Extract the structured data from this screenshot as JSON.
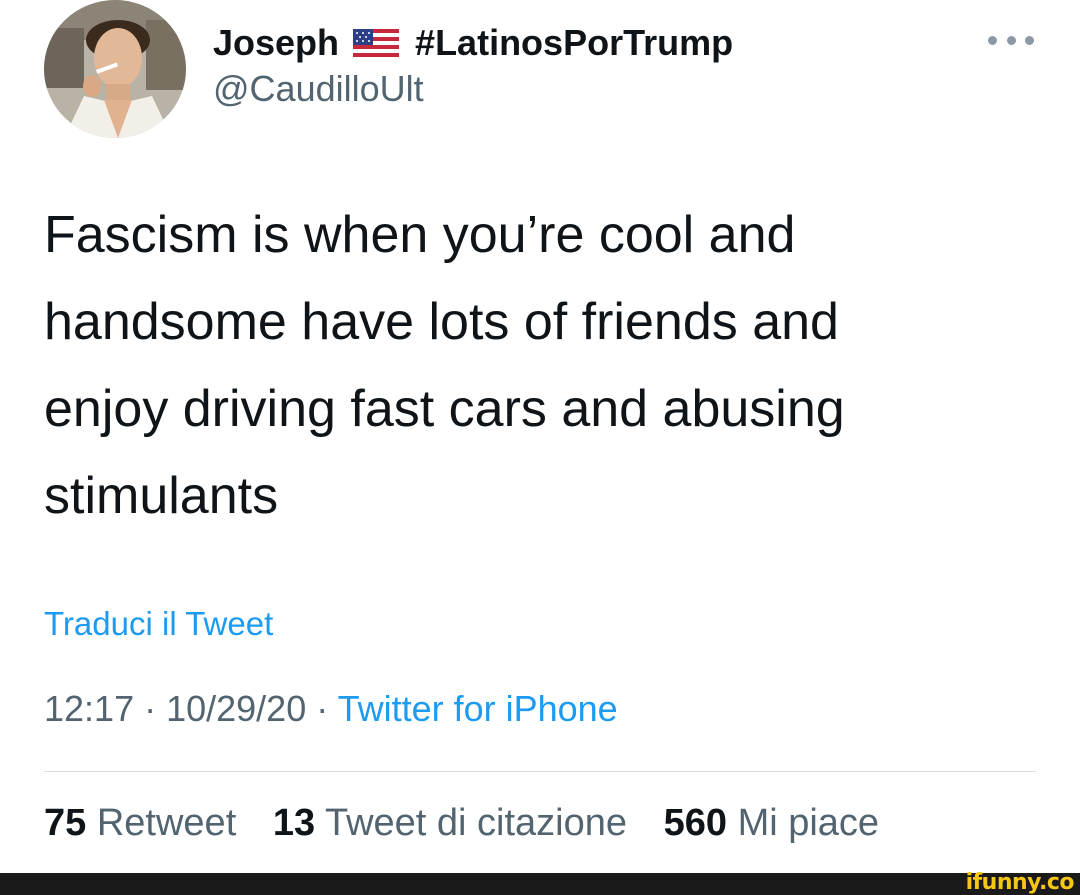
{
  "tweet": {
    "author": {
      "display_name": "Joseph",
      "flag_icon": "us-flag-icon",
      "hashtag": "#LatinosPorTrump",
      "handle": "@CaudilloUlt"
    },
    "text_lines": [
      "Fascism is when you’re cool and",
      "handsome have lots of friends and",
      "enjoy driving fast cars and abusing",
      "stimulants"
    ],
    "translate_label": "Traduci il Tweet",
    "meta": {
      "time": "12:17",
      "separator": " · ",
      "date": "10/29/20",
      "source": "Twitter for iPhone"
    },
    "stats": {
      "retweets": {
        "count": "75",
        "label": "Retweet"
      },
      "quotes": {
        "count": "13",
        "label": "Tweet di citazione"
      },
      "likes": {
        "count": "560",
        "label": "Mi piace"
      }
    }
  },
  "watermark": "ifunny.co",
  "colors": {
    "link": "#1d9bf0",
    "secondary_text": "#536471",
    "primary_text": "#0f1419"
  }
}
